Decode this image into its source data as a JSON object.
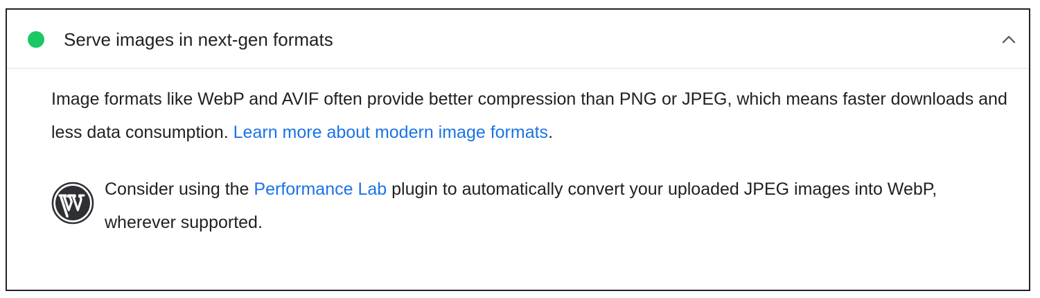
{
  "audit": {
    "title": "Serve images in next-gen formats",
    "status_color": "#18c964",
    "status": "pass",
    "expanded": true,
    "chevron_icon": "chevron-up-icon",
    "description": {
      "text": "Image formats like WebP and AVIF often provide better compression than PNG or JPEG, which means faster downloads and less data consumption. ",
      "link_text": "Learn more about modern image formats",
      "trailing": "."
    },
    "stack_pack": {
      "icon": "wordpress-icon",
      "prefix": "Consider using the ",
      "link_text": "Performance Lab",
      "suffix": " plugin to automatically convert your uploaded JPEG images into WebP, wherever supported."
    }
  },
  "colors": {
    "link": "#1a73e8",
    "text": "#212121",
    "border": "#202124",
    "divider": "#e0e0e0"
  }
}
